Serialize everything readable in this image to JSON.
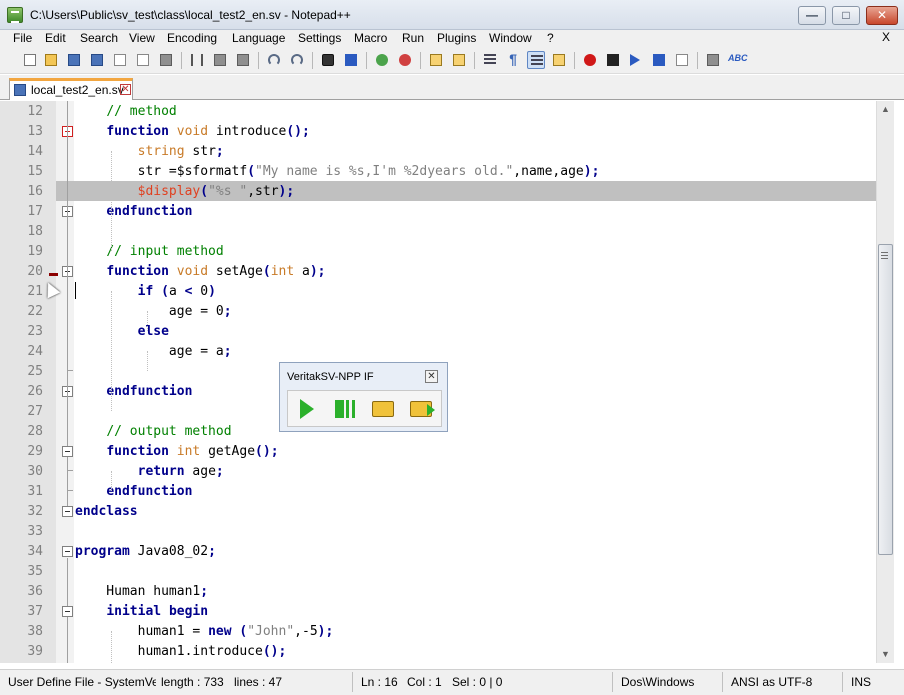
{
  "window": {
    "title": "C:\\Users\\Public\\sv_test\\class\\local_test2_en.sv - Notepad++",
    "minimize_glyph": "—",
    "maximize_glyph": "□",
    "close_glyph": "✕"
  },
  "menu": {
    "items": [
      "File",
      "Edit",
      "Search",
      "View",
      "Encoding",
      "Language",
      "Settings",
      "Macro",
      "Run",
      "Plugins",
      "Window",
      "?"
    ],
    "close": "X"
  },
  "toolbar": {
    "icons": [
      "new-file-icon",
      "open-file-icon",
      "save-icon",
      "save-all-icon",
      "close-icon",
      "close-all-icon",
      "print-icon",
      "cut-icon",
      "copy-icon",
      "paste-icon",
      "undo-icon",
      "redo-icon",
      "find-icon",
      "replace-icon",
      "zoom-in-icon",
      "zoom-out-icon",
      "sync-vertical-icon",
      "sync-horizontal-icon",
      "word-wrap-icon",
      "show-all-chars-icon",
      "indent-guide-icon",
      "user-lang-icon",
      "record-macro-icon",
      "stop-record-icon",
      "play-macro-icon",
      "run-macro-multiple-icon",
      "save-macro-icon",
      "trim-icon",
      "spellcheck-icon"
    ],
    "spellcheck_text": "ABC",
    "paragraph_glyph": "¶"
  },
  "tab": {
    "label": "local_test2_en.sv",
    "close_glyph": "✕"
  },
  "editor": {
    "lines": [
      {
        "n": "12",
        "html": "    <span class='cm'>// method</span>"
      },
      {
        "n": "13",
        "html": "    <span class='kw'>function</span> <span class='ty'>void</span> introduce<span class='op'>();</span>"
      },
      {
        "n": "14",
        "html": "        <span class='ty'>string</span> str<span class='op'>;</span>"
      },
      {
        "n": "15",
        "html": "        str =$sformatf<span class='op'>(</span><span class='st'>\"My name is %s,I'm %2dyears old.\"</span>,name,age<span class='op'>);</span>"
      },
      {
        "n": "16",
        "html": "        <span class='sysf'>$display</span><span class='op'>(</span><span class='st'>\"%s \"</span>,str<span class='op'>);</span>"
      },
      {
        "n": "17",
        "html": "    <span class='kw'>endfunction</span>"
      },
      {
        "n": "18",
        "html": ""
      },
      {
        "n": "19",
        "html": "    <span class='cm'>// input method</span>"
      },
      {
        "n": "20",
        "html": "    <span class='kw'>function</span> <span class='ty'>void</span> setAge<span class='op'>(</span><span class='ty'>int</span> a<span class='op'>);</span>"
      },
      {
        "n": "21",
        "html": "        <span class='kw'>if</span> <span class='op'>(</span>a <span class='op'>&lt;</span> 0<span class='op'>)</span>"
      },
      {
        "n": "22",
        "html": "            age = 0<span class='op'>;</span>"
      },
      {
        "n": "23",
        "html": "        <span class='kw'>else</span>"
      },
      {
        "n": "24",
        "html": "            age = a<span class='op'>;</span>"
      },
      {
        "n": "25",
        "html": ""
      },
      {
        "n": "26",
        "html": "    <span class='kw'>endfunction</span>"
      },
      {
        "n": "27",
        "html": ""
      },
      {
        "n": "28",
        "html": "    <span class='cm'>// output method</span>"
      },
      {
        "n": "29",
        "html": "    <span class='kw'>function</span> <span class='ty'>int</span> getAge<span class='op'>();</span>"
      },
      {
        "n": "30",
        "html": "        <span class='kw'>return</span> age<span class='op'>;</span>"
      },
      {
        "n": "31",
        "html": "    <span class='kw'>endfunction</span>"
      },
      {
        "n": "32",
        "html": "<span class='kw'>endclass</span>"
      },
      {
        "n": "33",
        "html": ""
      },
      {
        "n": "34",
        "html": "<span class='kw'>program</span> Java08_02<span class='op'>;</span>"
      },
      {
        "n": "35",
        "html": ""
      },
      {
        "n": "36",
        "html": "    Human human1<span class='op'>;</span>"
      },
      {
        "n": "37",
        "html": "    <span class='kw'>initial</span> <span class='kw'>begin</span>"
      },
      {
        "n": "38",
        "html": "        human1 = <span class='kw'>new</span> <span class='op'>(</span><span class='st'>\"John\"</span>,-5<span class='op'>);</span>"
      },
      {
        "n": "39",
        "html": "        human1.introduce<span class='op'>();</span>"
      }
    ],
    "current_line": "16"
  },
  "plugin_panel": {
    "title": "VeritakSV-NPP IF",
    "close_glyph": "✕",
    "buttons": [
      "run-icon",
      "step-run-icon",
      "open-folder-icon",
      "open-folder-run-icon"
    ]
  },
  "scrollbar": {
    "up_glyph": "▲",
    "down_glyph": "▼"
  },
  "statusbar": {
    "filetype": "User Define File - SystemVer",
    "length": "length : 733",
    "lines": "lines : 47",
    "ln": "Ln : 16",
    "col": "Col : 1",
    "sel": "Sel : 0 | 0",
    "eol": "Dos\\Windows",
    "encoding": "ANSI as UTF-8",
    "mode": "INS"
  }
}
